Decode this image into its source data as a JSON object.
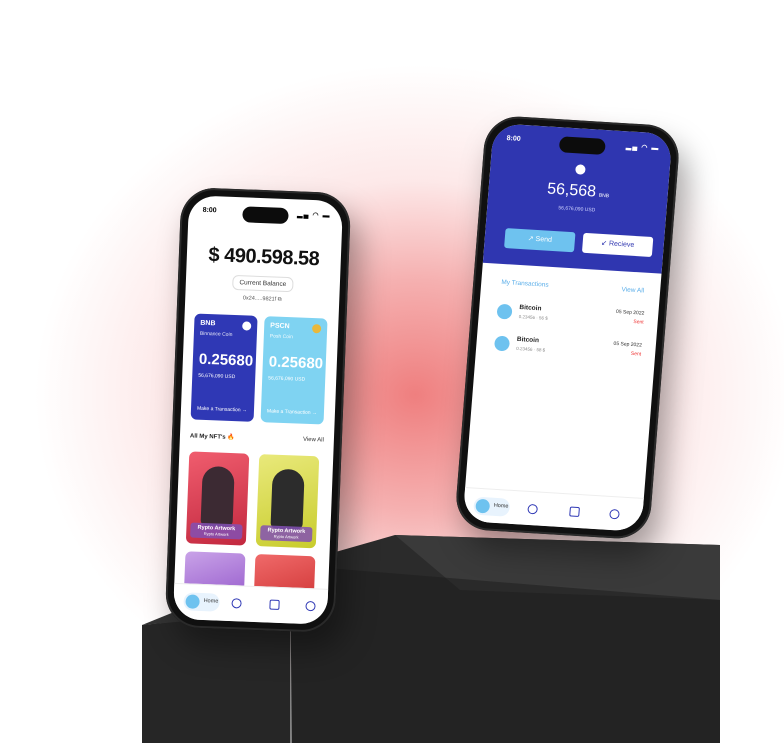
{
  "phone_left": {
    "status_time": "8:00",
    "balance": "$ 490.598.58",
    "balance_label": "Current Balance",
    "wallet_address": "0x24.....9821f",
    "cards": [
      {
        "ticker": "BNB",
        "name": "Binnance Coin",
        "amount": "0.25680",
        "usd": "56,676,090 USD",
        "action": "Make a Transaction"
      },
      {
        "ticker": "PSCN",
        "name": "Posh Coin",
        "amount": "0.25680",
        "usd": "56,676,090 USD",
        "action": "Make a Transaction"
      }
    ],
    "nft_heading": "All My NFT's",
    "nft_view_all": "View All",
    "nfts": [
      {
        "title": "Rypto Artwork",
        "subtitle": "Rypto Artwork"
      },
      {
        "title": "Rypto Artwork",
        "subtitle": "Rypto Artwork"
      }
    ],
    "nav": {
      "home_label": "Home"
    }
  },
  "phone_right": {
    "status_time": "8:00",
    "balance": "56,568",
    "balance_unit": "BNB",
    "balance_usd": "56,676,090 USD",
    "send_label": "Send",
    "receive_label": "Recieve",
    "transactions_heading": "My Transactions",
    "view_all": "View All",
    "transactions": [
      {
        "coin": "Bitcoin",
        "detail": "0.23456 · 56 $",
        "date": "05 Sep 2022",
        "status": "Sent"
      },
      {
        "coin": "Bitcoin",
        "detail": "0.23456 · 58 $",
        "date": "05 Sep 2022",
        "status": "Sent"
      }
    ],
    "nav": {
      "home_label": "Home"
    }
  },
  "colors": {
    "primary_blue": "#2f36b0",
    "light_blue": "#6ec2ef",
    "status_red": "#e33333",
    "glow": "#ee7878"
  }
}
